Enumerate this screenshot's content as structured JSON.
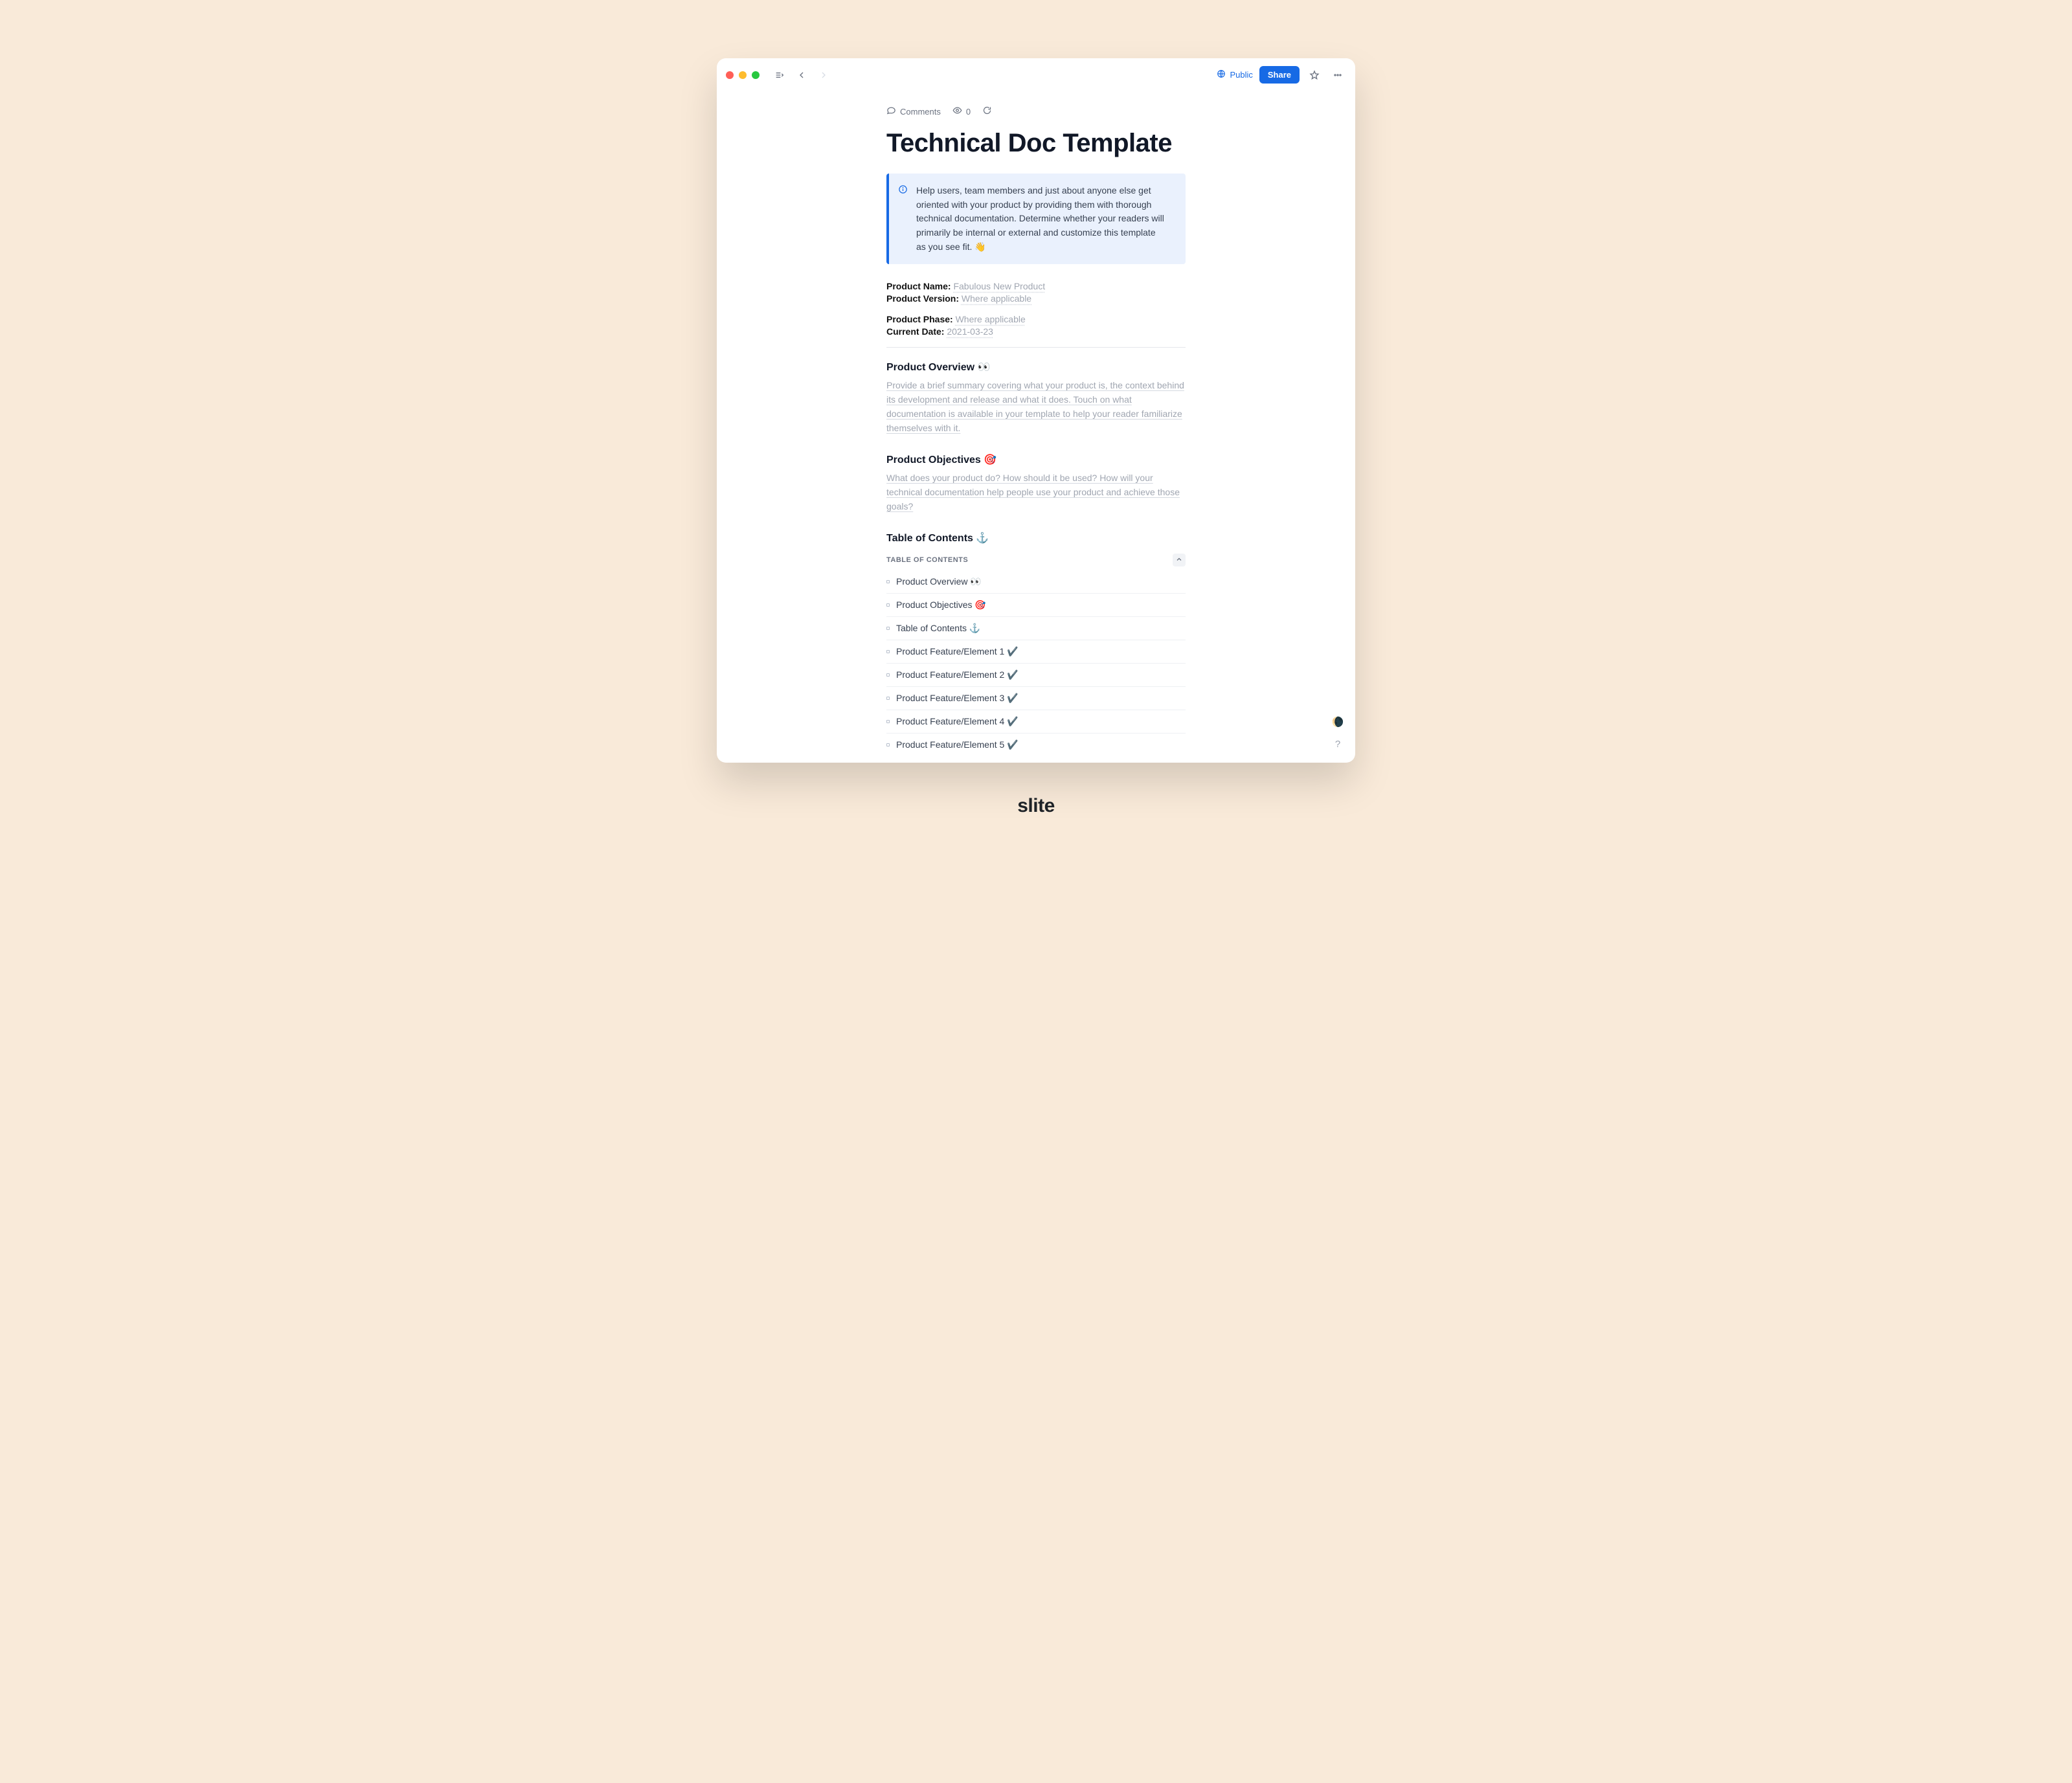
{
  "header": {
    "public_label": "Public",
    "share_label": "Share"
  },
  "meta": {
    "comments_label": "Comments",
    "views_count": "0"
  },
  "title": "Technical Doc Template",
  "callout": {
    "text": "Help users, team members and just about anyone else get oriented with your product by providing them with thorough technical documentation. Determine whether your readers will primarily be internal or external and customize this template as you see fit. 👋"
  },
  "fields_a": [
    {
      "label": "Product Name:",
      "value": "Fabulous New Product"
    },
    {
      "label": "Product Version:",
      "value": "Where applicable"
    }
  ],
  "fields_b": [
    {
      "label": "Product Phase:",
      "value": "Where applicable"
    },
    {
      "label": "Current Date:",
      "value": "2021-03-23"
    }
  ],
  "sections": {
    "overview": {
      "heading": "Product Overview 👀",
      "placeholder": "Provide a brief summary covering what your product is, the context behind its development and release and what it does. Touch on what documentation is available in your template to help your reader familiarize themselves with it."
    },
    "objectives": {
      "heading": "Product Objectives 🎯",
      "placeholder": "What does your product do? How should it be used? How will your technical documentation help people use your product and achieve those goals?"
    },
    "toc_heading": "Table of Contents ⚓"
  },
  "toc": {
    "label": "TABLE OF CONTENTS",
    "items": [
      "Product Overview 👀",
      "Product Objectives 🎯",
      "Table of Contents ⚓",
      "Product Feature/Element 1 ✔️",
      "Product Feature/Element 2 ✔️",
      "Product Feature/Element 3 ✔️",
      "Product Feature/Element 4 ✔️",
      "Product Feature/Element 5 ✔️"
    ]
  },
  "brand": "slite",
  "floating": {
    "theme_icon": "🌘",
    "help_icon": "?"
  }
}
